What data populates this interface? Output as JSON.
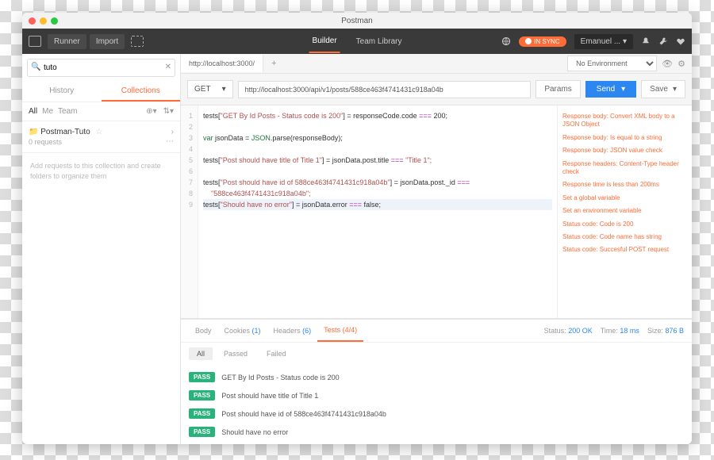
{
  "title": "Postman",
  "topbar": {
    "runner": "Runner",
    "import": "Import",
    "builder": "Builder",
    "library": "Team Library",
    "sync": "IN SYNC",
    "user": "Emanuel ..."
  },
  "sidebar": {
    "search": "tuto",
    "history": "History",
    "collections": "Collections",
    "all": "All",
    "me": "Me",
    "team": "Team",
    "coll_name": "Postman-Tuto",
    "coll_sub": "0 requests",
    "hint": "Add requests to this collection and create folders to organize them"
  },
  "req": {
    "tab": "http://localhost:3000/",
    "method": "GET",
    "url": "http://localhost:3000/api/v1/posts/588ce463f4741431c918a04b",
    "env": "No Environment",
    "params": "Params",
    "send": "Send",
    "save": "Save"
  },
  "code": {
    "l1a": "tests[",
    "l1b": "\"GET By Id Posts - Status code is 200\"",
    "l1c": "] = responseCode.code ",
    "l1d": "===",
    "l1e": " 200;",
    "l3a": "var",
    "l3b": " jsonData = ",
    "l3c": "JSON",
    ". parse": "(responseBody);",
    "l3d": ".parse(responseBody);",
    "l5a": "tests[",
    "l5b": "\"Post should have title of Title 1\"",
    "l5c": "] = jsonData.post.title ",
    "l5d": "===",
    "l5e": " \"Title 1\";",
    "l7a": "tests[",
    "l7b": "\"Post should have id of 588ce463f4741431c918a04b\"",
    "l7c": "] = jsonData.post._id ",
    "l7d": "===",
    "l8": "    \"588ce463f4741431c918a04b\";",
    "l9a": "tests[",
    "l9b": "\"Should have no error\"",
    "l9c": "] = jsonData.error ",
    "l9d": "===",
    "l9e": " false;"
  },
  "snippets": [
    "Response body: Convert XML body to a JSON Object",
    "Response body: Is equal to a string",
    "Response body: JSON value check",
    "Response headers: Content-Type header check",
    "Response time is less than 200ms",
    "Set a global variable",
    "Set an environment variable",
    "Status code: Code is 200",
    "Status code: Code name has string",
    "Status code: Succesful POST request"
  ],
  "resp": {
    "body": "Body",
    "cookies": "Cookies",
    "cc": "(1)",
    "headers": "Headers",
    "hc": "(6)",
    "tests": "Tests",
    "tc": "(4/4)",
    "status_l": "Status:",
    "status_v": "200 OK",
    "time_l": "Time:",
    "time_v": "18 ms",
    "size_l": "Size:",
    "size_v": "876 B",
    "all": "All",
    "passed": "Passed",
    "failed": "Failed"
  },
  "results": [
    {
      "b": "PASS",
      "t": "GET By Id Posts - Status code is 200"
    },
    {
      "b": "PASS",
      "t": "Post should have title of Title 1"
    },
    {
      "b": "PASS",
      "t": "Post should have id of 588ce463f4741431c918a04b"
    },
    {
      "b": "PASS",
      "t": "Should have no error"
    }
  ]
}
